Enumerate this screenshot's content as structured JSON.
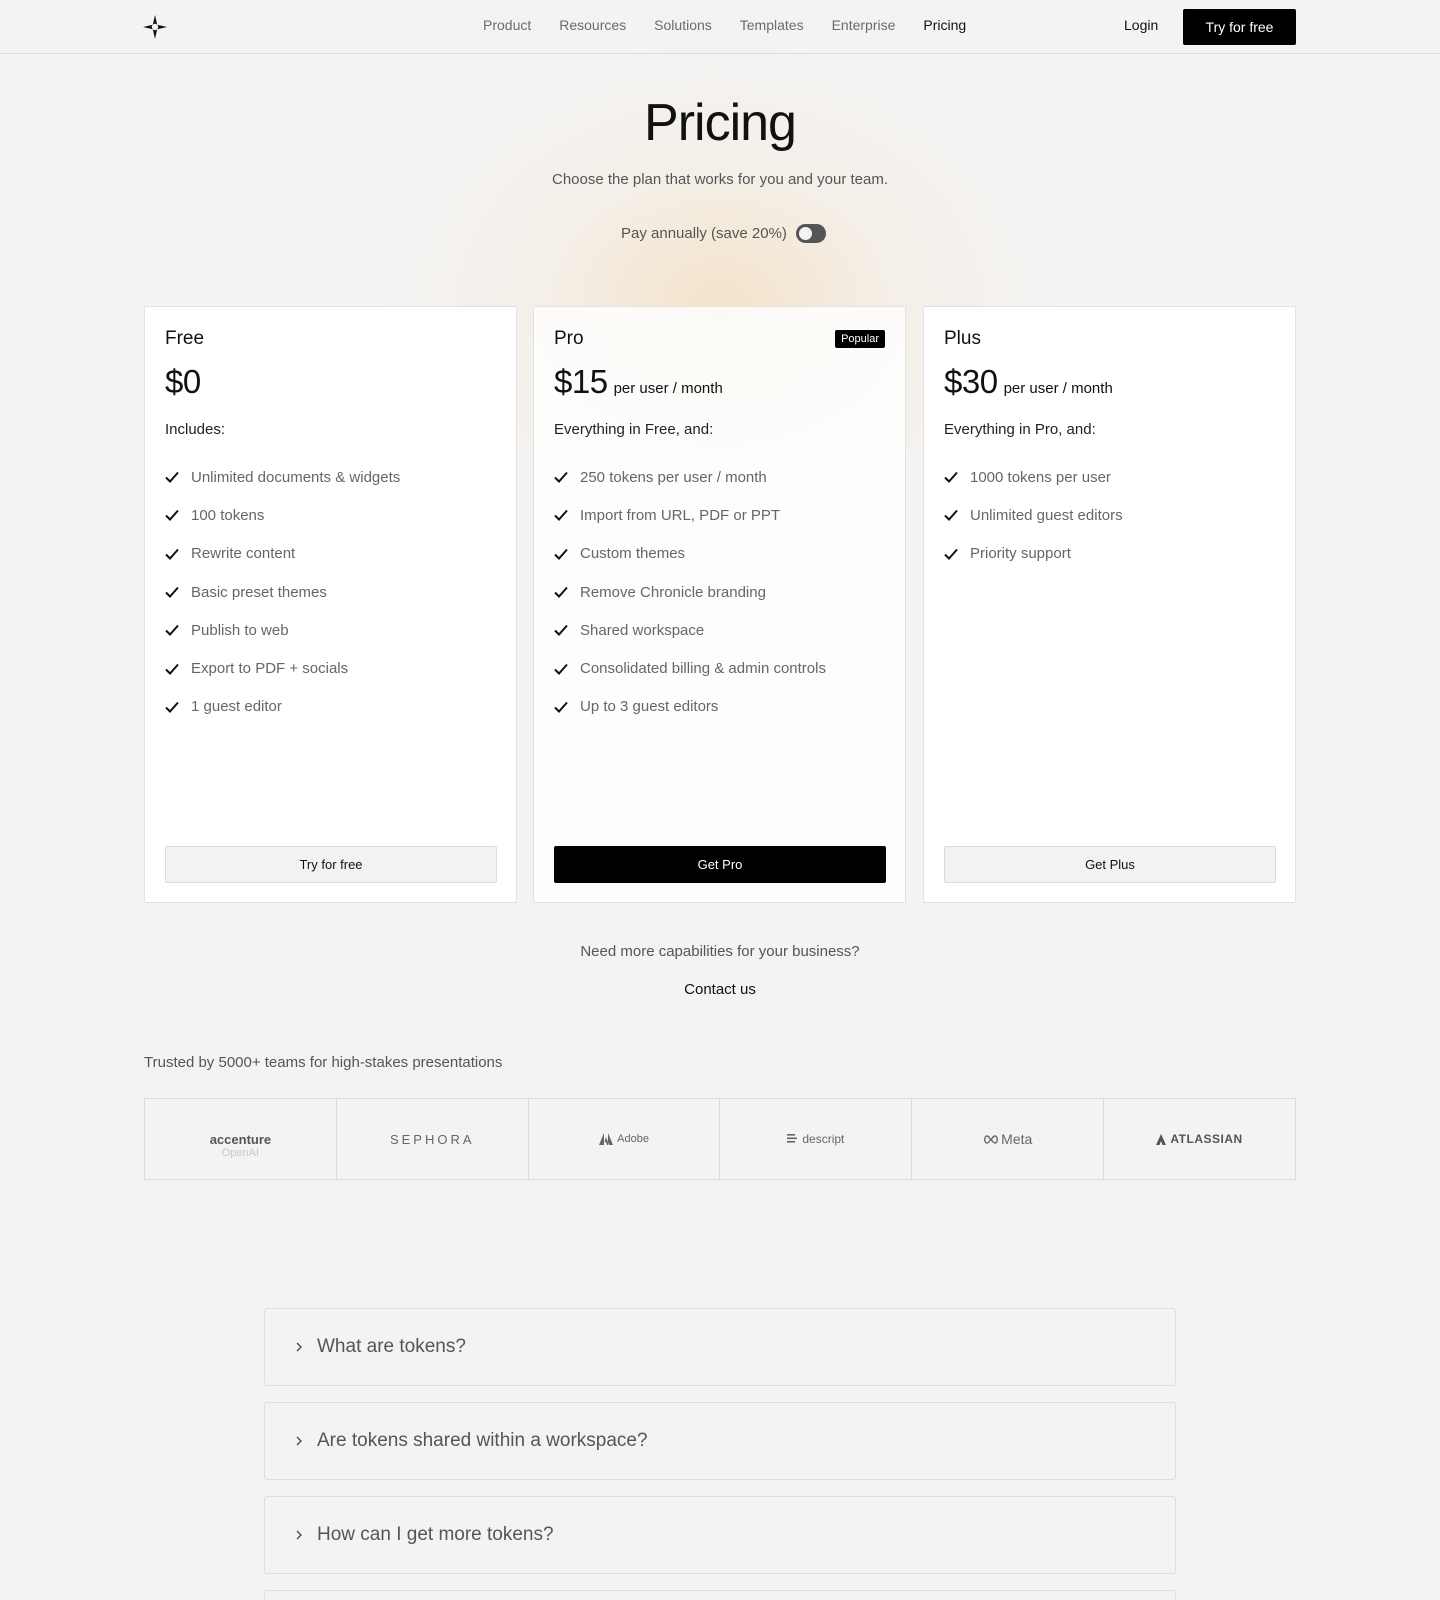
{
  "nav": {
    "links": [
      "Product",
      "Resources",
      "Solutions",
      "Templates",
      "Enterprise",
      "Pricing"
    ],
    "active": "Pricing",
    "login": "Login",
    "cta": "Try for free"
  },
  "header": {
    "title": "Pricing",
    "subtitle": "Choose the plan that works for you and your team.",
    "toggle_label": "Pay annually (save 20%)",
    "toggle_on": false
  },
  "plans": [
    {
      "name": "Free",
      "price": "$0",
      "period": "",
      "includes": "Includes:",
      "features": [
        "Unlimited documents & widgets",
        "100 tokens",
        "Rewrite content",
        "Basic preset themes",
        "Publish to web",
        "Export to PDF + socials",
        "1 guest editor"
      ],
      "button": "Try for free"
    },
    {
      "name": "Pro",
      "badge": "Popular",
      "price": "$15",
      "period": "per user / month",
      "includes": "Everything in Free, and:",
      "features": [
        "250 tokens per user / month",
        "Import from URL, PDF or PPT",
        "Custom themes",
        "Remove Chronicle branding",
        "Shared workspace",
        "Consolidated billing & admin controls",
        "Up to 3 guest editors"
      ],
      "button": "Get Pro"
    },
    {
      "name": "Plus",
      "price": "$30",
      "period": "per user / month",
      "includes": "Everything in Pro, and:",
      "features": [
        "1000 tokens per user",
        "Unlimited guest editors",
        "Priority support"
      ],
      "button": "Get Plus"
    }
  ],
  "business": {
    "question": "Need more capabilities for your business?",
    "contact": "Contact us"
  },
  "trusted": {
    "text": "Trusted by 5000+ teams for high-stakes presentations",
    "logos": [
      "accenture",
      "SEPHORA",
      "Adobe",
      "descript",
      "Meta",
      "ATLASSIAN"
    ],
    "faded": [
      "OpenAI"
    ]
  },
  "faq": [
    "What are tokens?",
    "Are tokens shared within a workspace?",
    "How can I get more tokens?"
  ]
}
